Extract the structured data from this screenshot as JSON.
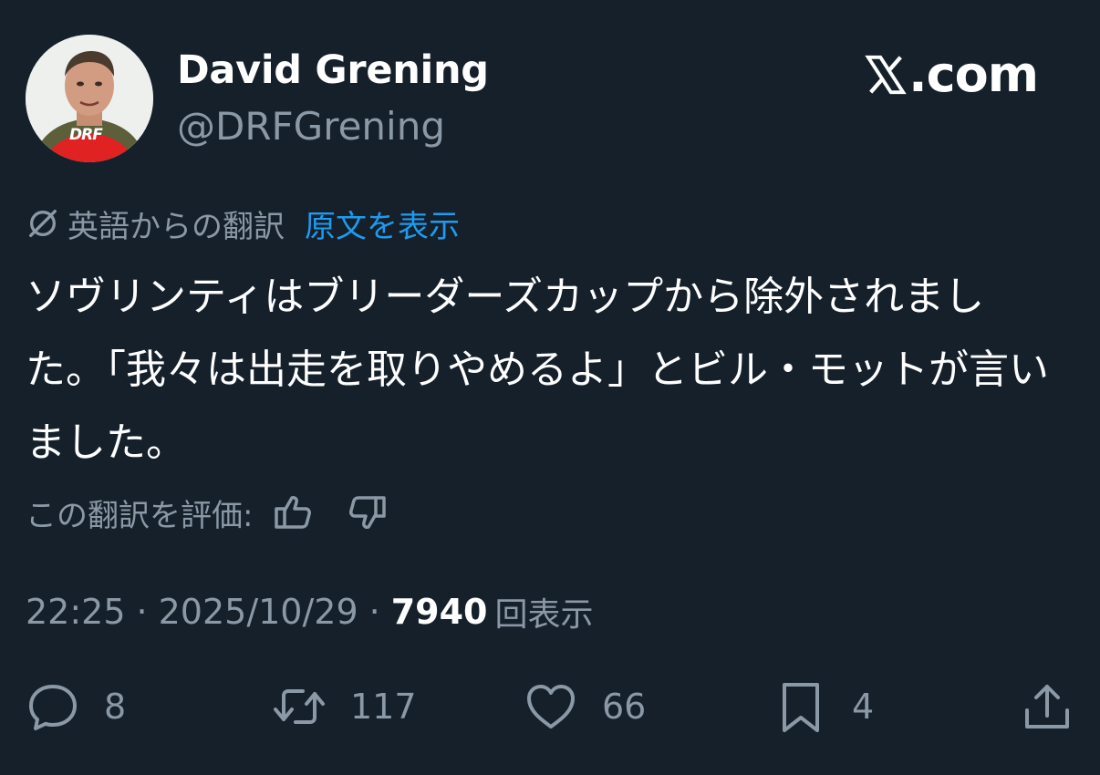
{
  "author": {
    "display_name": "David Grening",
    "handle": "@DRFGrening",
    "avatar_badge": "DRF"
  },
  "brand": {
    "text": ".com",
    "icon": "x-logo-icon"
  },
  "translation": {
    "label": "英語からの翻訳",
    "show_original": "原文を表示",
    "icon": "translate-icon"
  },
  "tweet": {
    "text": "ソヴリンティはブリーダーズカップから除外されました。「我々は出走を取りやめるよ」とビル・モットが言いました。"
  },
  "rating": {
    "label": "この翻訳を評価:",
    "thumbs_up_icon": "thumbs-up-icon",
    "thumbs_down_icon": "thumbs-down-icon"
  },
  "meta": {
    "time": "22:25",
    "separator": "·",
    "date": "2025/10/29",
    "views_count": "7940",
    "views_label": "回表示"
  },
  "actions": {
    "replies": "8",
    "reposts": "117",
    "likes": "66",
    "bookmarks": "4"
  },
  "colors": {
    "background": "#15202b",
    "primary_text": "#ffffff",
    "secondary_text": "#8b98a5",
    "link": "#1d9bf0"
  }
}
